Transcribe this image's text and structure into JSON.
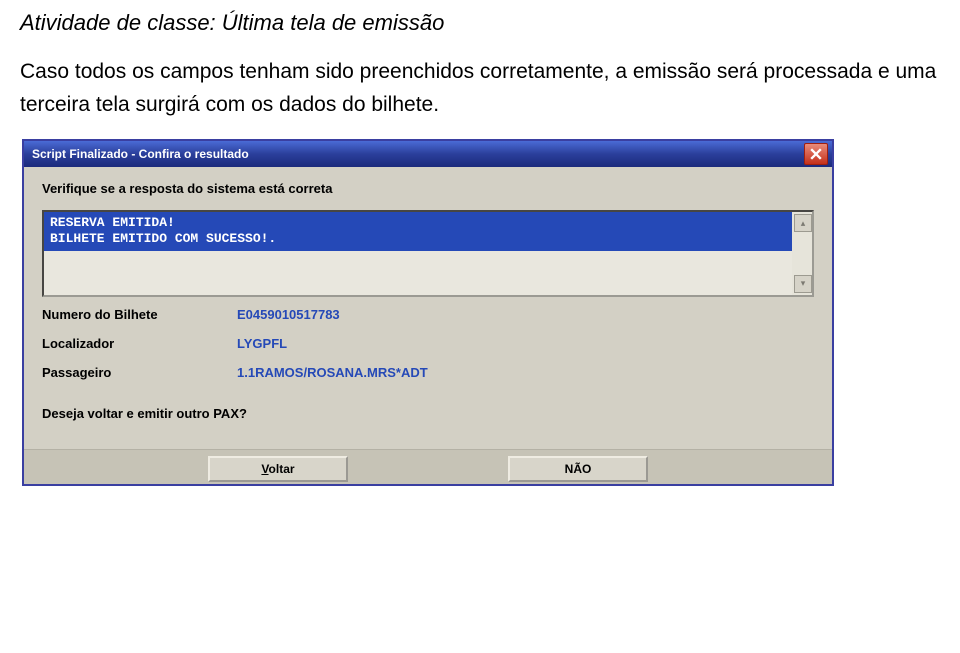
{
  "header": {
    "activity_title": "Atividade de classe: Última tela de emissão",
    "paragraph": "Caso todos os campos tenham sido preenchidos corretamente, a emissão será processada e uma terceira tela surgirá com os dados do bilhete."
  },
  "window": {
    "title": "Script Finalizado - Confira o resultado",
    "verify_label": "Verifique se a resposta do sistema está correta",
    "result_lines": {
      "line1": "RESERVA EMITIDA!",
      "line2": " BILHETE EMITIDO COM SUCESSO!."
    },
    "fields": {
      "ticket_label": "Numero do Bilhete",
      "ticket_value": "E0459010517783",
      "locator_label": "Localizador",
      "locator_value": "LYGPFL",
      "pax_label": "Passageiro",
      "pax_value": "1.1RAMOS/ROSANA.MRS*ADT"
    },
    "question": "Deseja voltar e emitir outro PAX?",
    "buttons": {
      "back_underline": "V",
      "back_rest": "oltar",
      "no": "NÃO"
    }
  }
}
